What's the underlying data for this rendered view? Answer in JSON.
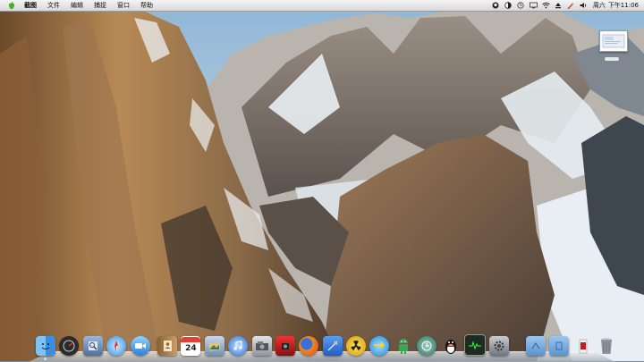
{
  "menubar": {
    "apple_icon": "apple-logo-icon",
    "items": [
      "截图",
      "文件",
      "编辑",
      "捕捉",
      "窗口",
      "帮助"
    ],
    "status_icons": [
      "tencent-icon",
      "contrast-icon",
      "time-machine-icon",
      "display-icon",
      "wifi-icon",
      "eject-icon",
      "pen-icon",
      "volume-icon"
    ],
    "day": "周六",
    "time": "下午11:06"
  },
  "dock": {
    "items": [
      {
        "name": "finder",
        "icon": "finder-icon",
        "color": "#3a8ee6"
      },
      {
        "name": "dashboard",
        "icon": "dashboard-icon",
        "color": "#2b2b2b"
      },
      {
        "name": "preview",
        "icon": "preview-icon",
        "color": "#5a7fb8"
      },
      {
        "name": "safari",
        "icon": "safari-icon",
        "color": "#2f8fe0"
      },
      {
        "name": "facetime",
        "icon": "facetime-icon",
        "color": "#4aa3e8"
      },
      {
        "name": "address-book",
        "icon": "address-book-icon",
        "color": "#b38a4d"
      },
      {
        "name": "ical",
        "icon": "calendar-icon",
        "color": "#e64030",
        "label": "24"
      },
      {
        "name": "iphoto",
        "icon": "iphoto-icon",
        "color": "#6f8fb6"
      },
      {
        "name": "itunes",
        "icon": "itunes-icon",
        "color": "#2a6bd6"
      },
      {
        "name": "image-capture",
        "icon": "image-capture-icon",
        "color": "#9aa4ad"
      },
      {
        "name": "photo-booth",
        "icon": "photo-booth-icon",
        "color": "#c21d1d"
      },
      {
        "name": "firefox",
        "icon": "firefox-icon",
        "color": "#e8711d"
      },
      {
        "name": "xcode",
        "icon": "xcode-icon",
        "color": "#3d7bd9"
      },
      {
        "name": "nuclear",
        "icon": "radiation-icon",
        "color": "#e0c020"
      },
      {
        "name": "migration",
        "icon": "arrows-icon",
        "color": "#2ea0e8"
      },
      {
        "name": "android",
        "icon": "android-icon",
        "color": "#39a853"
      },
      {
        "name": "time-machine",
        "icon": "time-machine-icon",
        "color": "#2a6b5a"
      },
      {
        "name": "qq",
        "icon": "qq-penguin-icon",
        "color": "#1b1b1b"
      },
      {
        "name": "activity-monitor",
        "icon": "activity-monitor-icon",
        "color": "#1e2a22"
      },
      {
        "name": "system-preferences",
        "icon": "system-preferences-icon",
        "color": "#8d9399"
      }
    ],
    "right_items": [
      {
        "name": "applications-folder",
        "icon": "applications-folder-icon",
        "color": "#6aa0d8"
      },
      {
        "name": "documents-folder",
        "icon": "documents-folder-icon",
        "color": "#6aa0d8"
      },
      {
        "name": "downloads-stack",
        "icon": "downloads-stack-icon",
        "color": "#c8c8c8"
      },
      {
        "name": "trash",
        "icon": "trash-icon",
        "color": "#8f969d"
      }
    ]
  }
}
